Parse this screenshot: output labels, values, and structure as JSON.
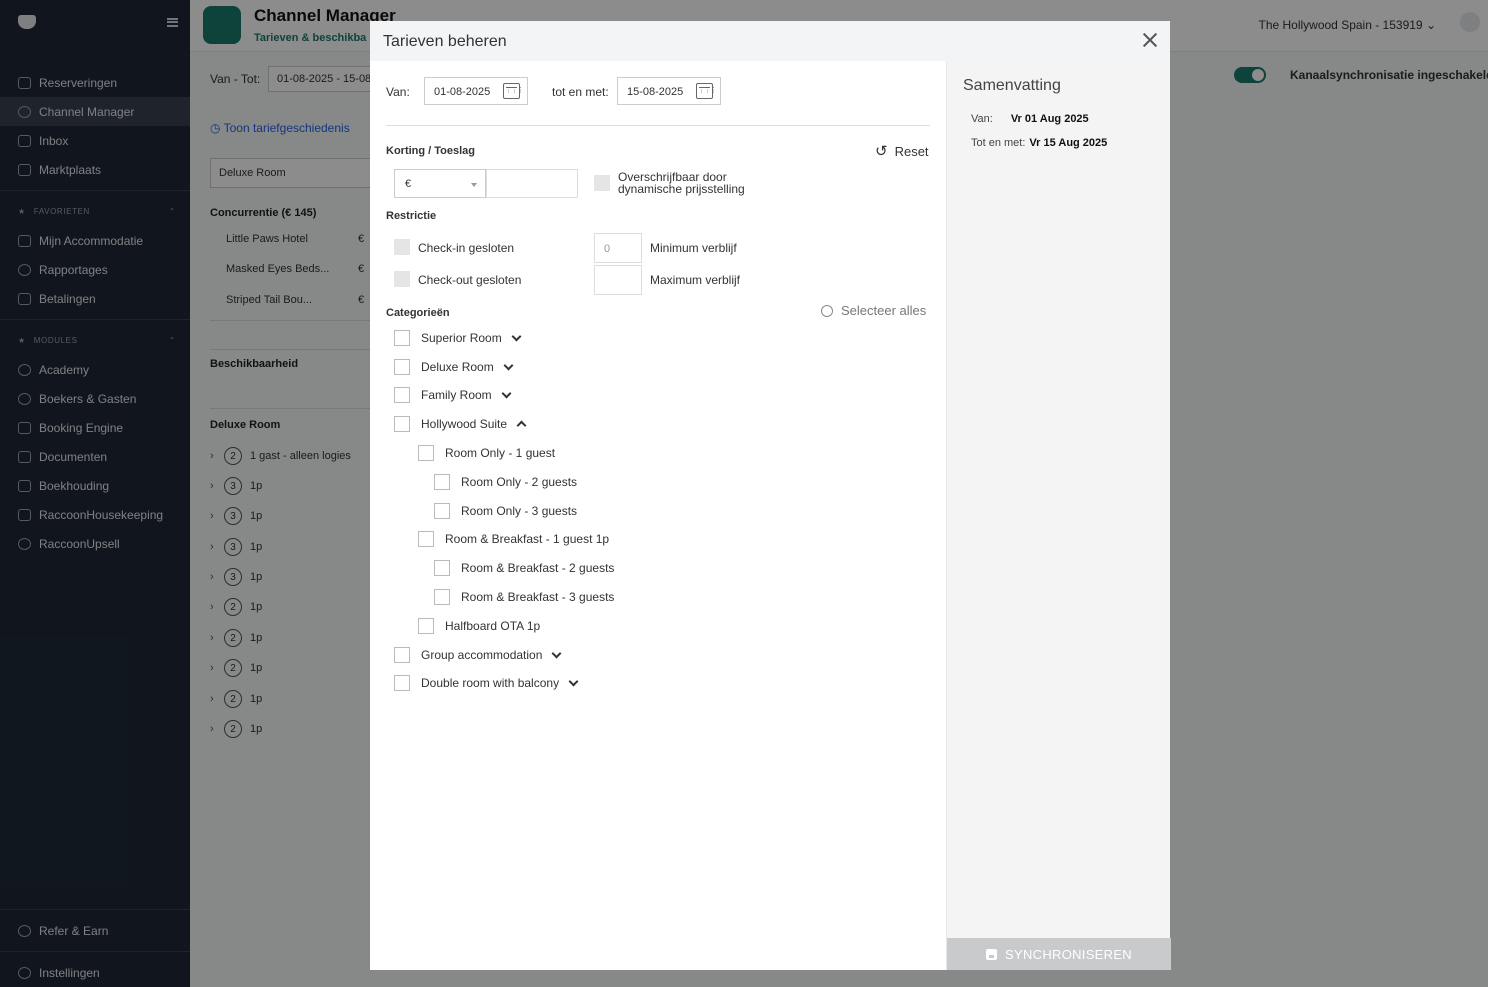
{
  "sidebar": {
    "items": [
      "Reserveringen",
      "Channel Manager",
      "Inbox",
      "Marktplaats"
    ],
    "favorites_label": "FAVORIETEN",
    "favorites": [
      "Mijn Accommodatie",
      "Rapportages",
      "Betalingen"
    ],
    "modules_label": "MODULES",
    "modules": [
      "Academy",
      "Boekers & Gasten",
      "Booking Engine",
      "Documenten",
      "Boekhouding",
      "RaccoonHousekeeping",
      "RaccoonUpsell"
    ],
    "refer": "Refer & Earn",
    "settings": "Instellingen"
  },
  "header": {
    "title": "Channel Manager",
    "subtitle": "Tarieven & beschikba",
    "account": "The Hollywood Spain - 153919"
  },
  "filters": {
    "label": "Van - Tot:",
    "dates": "01-08-2025 - 15-08",
    "sync_label": "Kanaalsynchronisatie ingeschakeld ("
  },
  "background": {
    "history_link": "Toon tariefgeschiedenis",
    "room_select": "Deluxe Room",
    "competition_heading": "Concurrentie (€ 145)",
    "competitors": [
      "Little Paws Hotel",
      "Masked Eyes Beds...",
      "Striped Tail Bou..."
    ],
    "euro": "€",
    "availability": "Beschikbaarheid",
    "room_heading": "Deluxe Room",
    "rates": [
      {
        "n": "2",
        "label": "1 gast - alleen logies"
      },
      {
        "n": "3",
        "label": "1p"
      },
      {
        "n": "3",
        "label": "1p"
      },
      {
        "n": "3",
        "label": "1p"
      },
      {
        "n": "3",
        "label": "1p"
      },
      {
        "n": "2",
        "label": "1p"
      },
      {
        "n": "2",
        "label": "1p"
      },
      {
        "n": "2",
        "label": "1p"
      },
      {
        "n": "2",
        "label": "1p"
      },
      {
        "n": "2",
        "label": "1p"
      }
    ]
  },
  "modal": {
    "title": "Tarieven beheren",
    "from_label": "Van:",
    "from_value": "01-08-2025",
    "to_label": "tot en met:",
    "to_value": "15-08-2025",
    "discount_label": "Korting / Toeslag",
    "reset": "Reset",
    "currency": "€",
    "override_line1": "Overschrijfbaar door",
    "override_line2": "dynamische prijsstelling",
    "restriction_label": "Restrictie",
    "checkin_closed": "Check-in gesloten",
    "checkout_closed": "Check-out gesloten",
    "min_placeholder": "0",
    "min_stay": "Minimum verblijf",
    "max_stay": "Maximum verblijf",
    "categories_label": "Categorieën",
    "select_all": "Selecteer alles",
    "categories": [
      "Superior Room",
      "Deluxe Room",
      "Family Room",
      "Hollywood Suite",
      "Room Only - 1 guest",
      "Room Only - 2 guests",
      "Room Only - 3 guests",
      "Room & Breakfast - 1 guest 1p",
      "Room & Breakfast - 2 guests",
      "Room & Breakfast - 3 guests",
      "Halfboard OTA 1p",
      "Group accommodation",
      "Double room with balcony"
    ]
  },
  "summary": {
    "title": "Samenvatting",
    "from_label": "Van:",
    "from_value": "Vr 01 Aug 2025",
    "to_label": "Tot en met:",
    "to_value": "Vr 15 Aug 2025",
    "sync_button": "SYNCHRONISEREN"
  },
  "colors": {
    "sidebar_bg": "#1f2937",
    "accent": "#1b7a6c",
    "sync_button_disabled": "#c9cacc"
  }
}
